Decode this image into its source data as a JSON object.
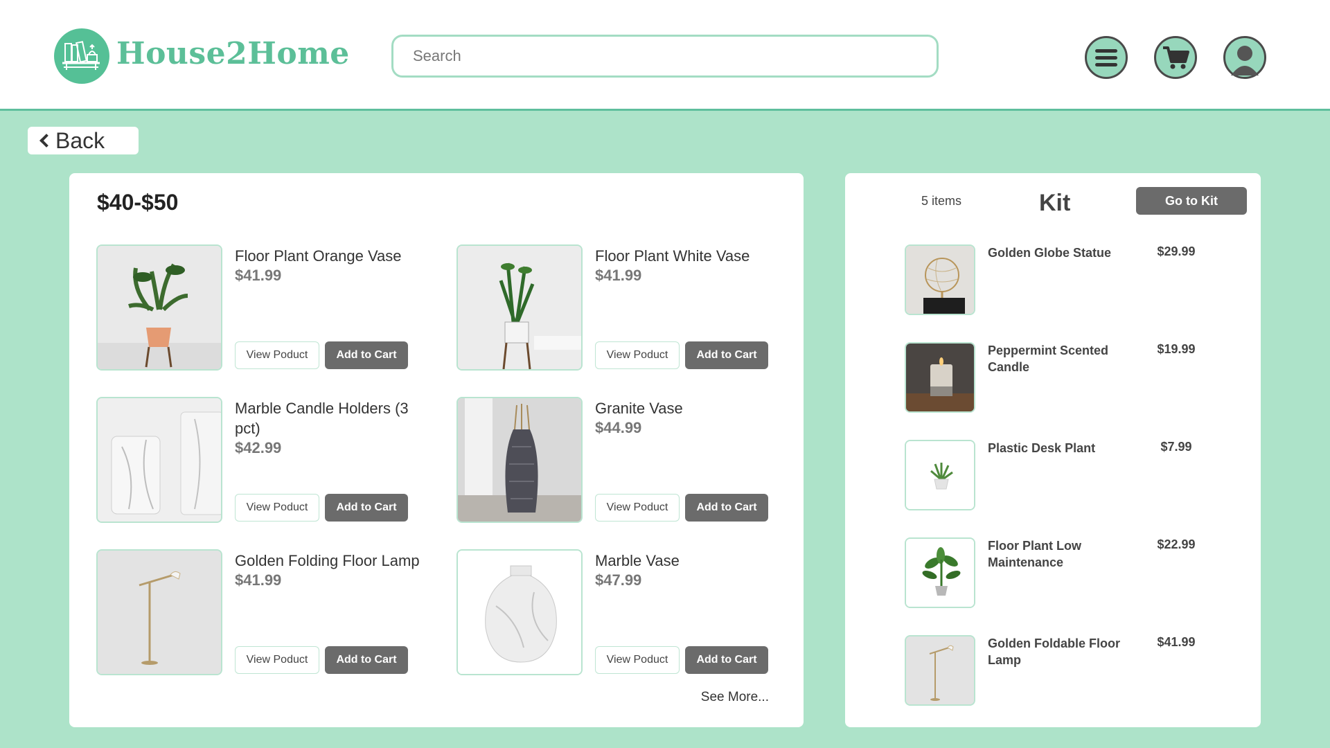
{
  "header": {
    "brand": "House2Home",
    "search_placeholder": "Search",
    "icons": [
      "menu-icon",
      "cart-icon",
      "profile-icon"
    ]
  },
  "back_label": "Back",
  "products": {
    "title": "$40-$50",
    "see_more": "See More...",
    "items": [
      {
        "name": "Floor Plant Orange Vase",
        "price": "$41.99",
        "view_label": "View Poduct",
        "add_label": "Add to Cart"
      },
      {
        "name": "Floor Plant White Vase",
        "price": "$41.99",
        "view_label": "View Poduct",
        "add_label": "Add to Cart"
      },
      {
        "name": "Marble Candle Holders (3 pct)",
        "price": "$42.99",
        "view_label": "View Poduct",
        "add_label": "Add to Cart"
      },
      {
        "name": "Granite Vase",
        "price": "$44.99",
        "view_label": "View Poduct",
        "add_label": "Add to Cart"
      },
      {
        "name": "Golden Folding Floor Lamp",
        "price": "$41.99",
        "view_label": "View Poduct",
        "add_label": "Add to Cart"
      },
      {
        "name": "Marble Vase",
        "price": "$47.99",
        "view_label": "View Poduct",
        "add_label": "Add to Cart"
      }
    ]
  },
  "kit": {
    "count": "5 items",
    "title": "Kit",
    "go_label": "Go to Kit",
    "items": [
      {
        "name": "Golden Globe Statue",
        "price": "$29.99"
      },
      {
        "name": "Peppermint Scented Candle",
        "price": "$19.99"
      },
      {
        "name": "Plastic Desk Plant",
        "price": "$7.99"
      },
      {
        "name": "Floor Plant Low Maintenance",
        "price": "$22.99"
      },
      {
        "name": "Golden Foldable Floor Lamp",
        "price": "$41.99"
      }
    ]
  },
  "colors": {
    "accent": "#5cbf98",
    "background": "#ade3c9",
    "button_dark": "#6b6b6b"
  }
}
